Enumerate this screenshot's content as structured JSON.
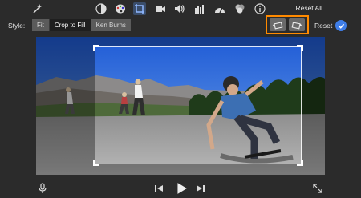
{
  "toolbar": {
    "icons": [
      "magic-wand-icon",
      "color-balance-icon",
      "color-palette-icon",
      "crop-icon",
      "camera-stabilization-icon",
      "volume-icon",
      "equalizer-icon",
      "clip-filter-icon",
      "info-icon"
    ],
    "active_icon": "crop-icon",
    "reset_all_label": "Reset All"
  },
  "style_row": {
    "label": "Style:",
    "options": [
      "Fit",
      "Crop to Fill",
      "Ken Burns"
    ],
    "selected": "Crop to Fill",
    "reset_label": "Reset"
  },
  "colors": {
    "background": "#2b2b2b",
    "highlight_box": "#ff8a00",
    "confirm": "#3f7ee8"
  },
  "playback": {
    "icons": [
      "microphone-icon",
      "skip-back-icon",
      "play-icon",
      "skip-forward-icon",
      "fullscreen-icon"
    ]
  }
}
